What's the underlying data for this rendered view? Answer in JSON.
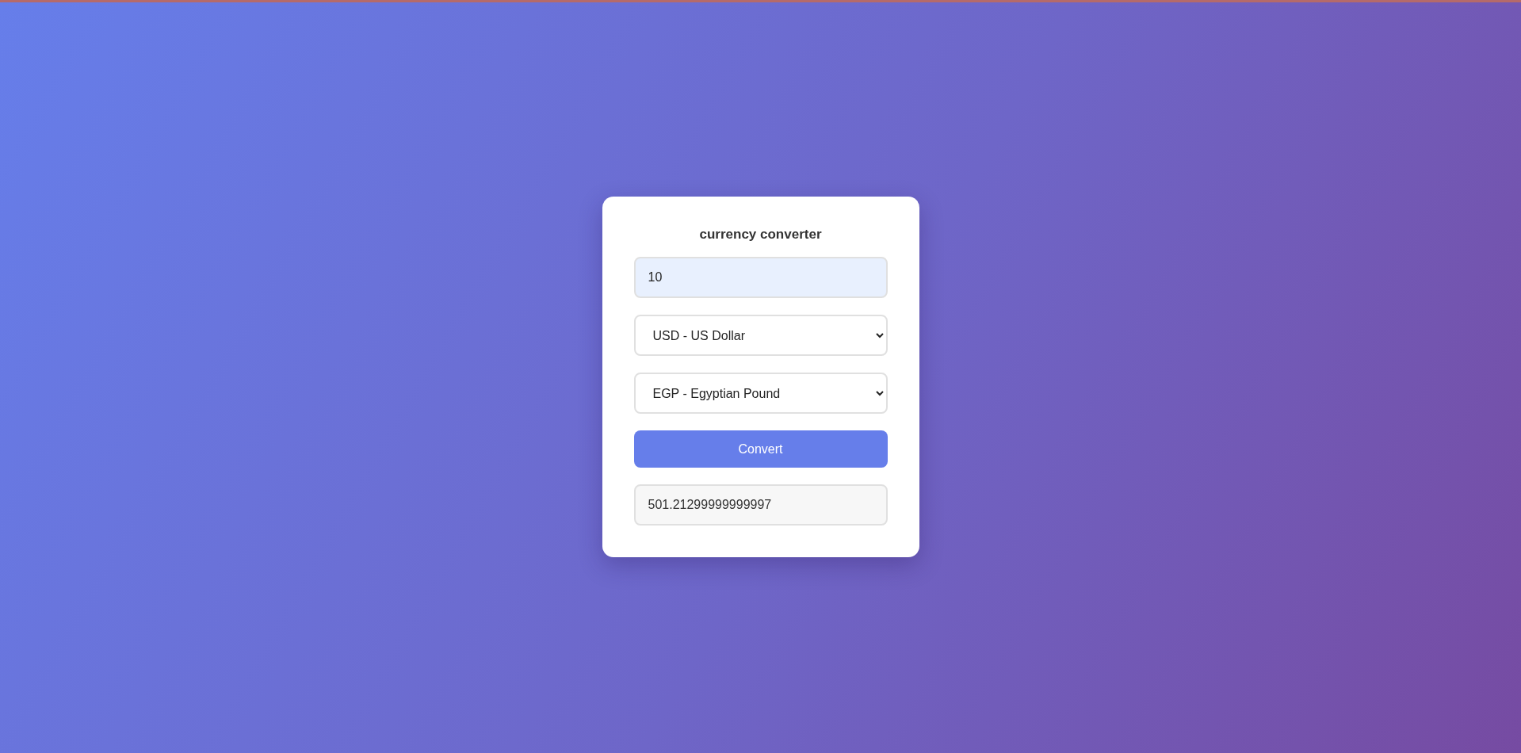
{
  "title": "currency converter",
  "amount": {
    "value": "10"
  },
  "from_currency": {
    "value": "USD - US Dollar"
  },
  "to_currency": {
    "value": "EGP - Egyptian Pound"
  },
  "convert_button": {
    "label": "Convert"
  },
  "result": {
    "value": "501.21299999999997"
  }
}
